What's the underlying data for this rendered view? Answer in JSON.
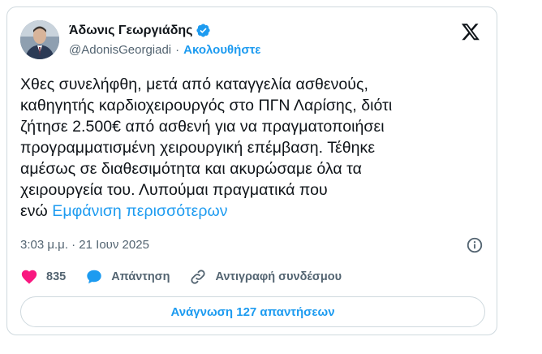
{
  "author": {
    "display_name": "Άδωνις Γεωργιάδης",
    "handle": "@AdonisGeorgiadi",
    "separator": "·",
    "follow_label": "Ακολουθήστε",
    "verified_icon": "verified-badge-icon",
    "avatar": "profile-photo"
  },
  "tweet": {
    "lines": [
      "Χθες συνελήφθη, μετά από καταγγελία ασθενούς,",
      "καθηγητής καρδιοχειρουργός στο ΠΓΝ Λαρίσης, διότι",
      "ζήτησε 2.500€ από ασθενή για να πραγματοποιήσει",
      "προγραμματισμένη χειρουργική επέμβαση. Τέθηκε",
      "αμέσως σε διαθεσιμότητα και ακυρώσαμε όλα τα",
      "χειρουργεία του. Λυπούμαι πραγματικά που"
    ],
    "last_line_prefix": "ενώ",
    "show_more": "Εμφάνιση περισσότερων",
    "timestamp": "3:03 μ.μ. · 21 Ιουν 2025"
  },
  "actions": {
    "likes": "835",
    "reply_label": "Απάντηση",
    "copy_link_label": "Αντιγραφή συνδέσμου",
    "read_replies_label": "Ανάγνωση 127 απαντήσεων"
  },
  "colors": {
    "accent": "#1d9bf0",
    "like": "#f91880",
    "text": "#0f1419",
    "muted": "#536471",
    "border": "#cfd9de"
  },
  "icons": [
    "x-logo-icon",
    "info-icon",
    "heart-icon",
    "reply-bubble-icon",
    "link-icon"
  ]
}
